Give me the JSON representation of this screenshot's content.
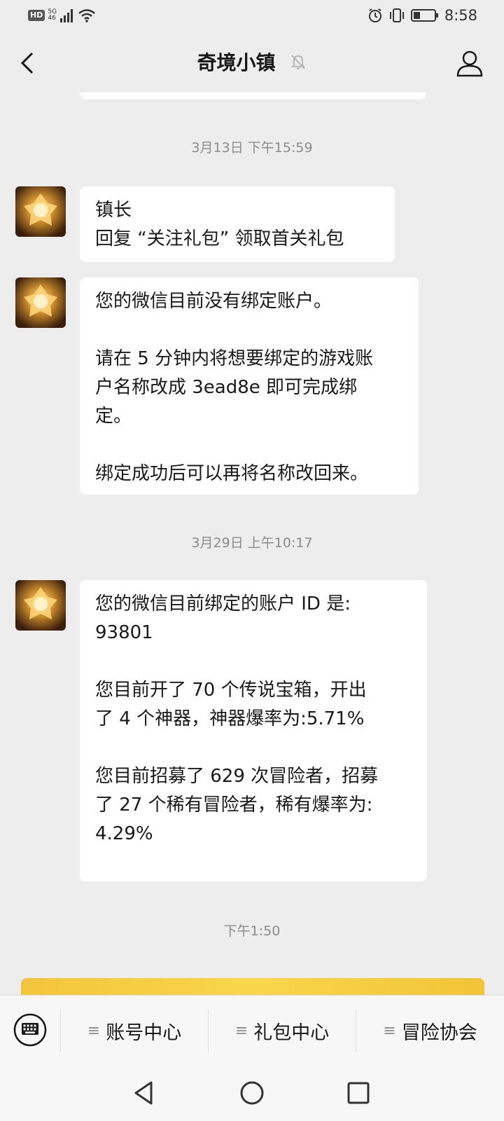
{
  "status_bar": {
    "hd": "HD",
    "network": "5G",
    "signal_sub": "46",
    "time": "8:58"
  },
  "nav": {
    "title": "奇境小镇"
  },
  "messages": [
    {
      "timestamp": "3月13日 下午15:59"
    },
    {
      "lines": [
        "镇长",
        "回复 “关注礼包” 领取首关礼包"
      ]
    },
    {
      "lines": [
        "您的微信目前没有绑定账户。",
        "",
        "请在 5 分钟内将想要绑定的游戏账",
        "户名称改成 3ead8e 即可完成绑",
        "定。",
        "",
        "绑定成功后可以再将名称改回来。"
      ]
    },
    {
      "timestamp": "3月29日 上午10:17"
    },
    {
      "lines": [
        "您的微信目前绑定的账户 ID 是:",
        "93801",
        "",
        "您目前开了 70 个传说宝箱，开出",
        "了 4 个神器，神器爆率为:5.71%",
        "",
        "您目前招募了 629 次冒险者，招募",
        "了 27 个稀有冒险者，稀有爆率为:",
        "4.29%"
      ]
    },
    {
      "timestamp": "下午1:50"
    }
  ],
  "menu": {
    "items": [
      {
        "label": "账号中心",
        "lines_icon": "≡"
      },
      {
        "label": "礼包中心",
        "lines_icon": "≡"
      },
      {
        "label": "冒险协会",
        "lines_icon": "≡"
      }
    ]
  },
  "colors": {
    "background": "#ededed",
    "bubble": "#ffffff",
    "timestamp": "#8c8c8c",
    "card": "#f5c940"
  }
}
